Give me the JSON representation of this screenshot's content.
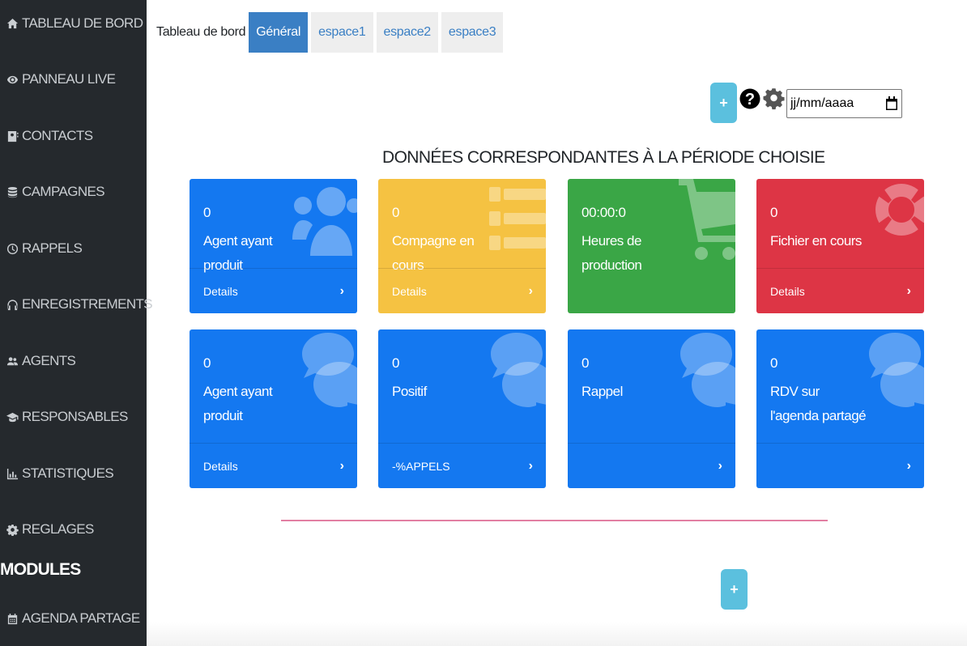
{
  "sidebar": {
    "items": [
      {
        "label": "TABLEAU DE BORD",
        "icon": "home-icon"
      },
      {
        "label": "PANNEAU LIVE",
        "icon": "eye-icon"
      },
      {
        "label": "CONTACTS",
        "icon": "address-book-icon"
      },
      {
        "label": "CAMPAGNES",
        "icon": "database-icon"
      },
      {
        "label": "RAPPELS",
        "icon": "clock-icon"
      },
      {
        "label": "ENREGISTREMENTS",
        "icon": "headphones-icon"
      },
      {
        "label": "AGENTS",
        "icon": "users-icon"
      },
      {
        "label": "RESPONSABLES",
        "icon": "graduation-cap-icon"
      },
      {
        "label": "STATISTIQUES",
        "icon": "chart-icon"
      },
      {
        "label": "REGLAGES",
        "icon": "gear-icon"
      }
    ],
    "modules_heading": "MODULES",
    "modules": [
      {
        "label": "AGENDA PARTAGE",
        "icon": "calendar-icon"
      }
    ]
  },
  "tabs": {
    "title": "Tableau de bord",
    "items": [
      "Général",
      "espace1",
      "espace2",
      "espace3"
    ],
    "active": "Général"
  },
  "toolbar": {
    "add_label": "+",
    "date_placeholder": "jj/mm/aaaa"
  },
  "section_title": "DONNÉES CORRESPONDANTES À LA PÉRIODE CHOISIE",
  "cards": [
    {
      "value": "0",
      "label": "Agent ayant produit",
      "footer": "Details",
      "color": "#1478f0",
      "icon": "users-icon"
    },
    {
      "value": "0",
      "label": "Compagne en cours",
      "footer": "Details",
      "color": "#f5c242",
      "icon": "list-icon"
    },
    {
      "value": "00:00:0",
      "label": "Heures de production",
      "footer": "",
      "color": "#3aa646",
      "icon": "shopping-cart-icon"
    },
    {
      "value": "0",
      "label": "Fichier en cours",
      "footer": "Details",
      "color": "#dd3545",
      "icon": "life-ring-icon"
    },
    {
      "value": "0",
      "label": "Agent ayant produit",
      "footer": "Details",
      "color": "#1478f0",
      "icon": "comments-icon"
    },
    {
      "value": "0",
      "label": "Positif",
      "footer": "-%APPELS",
      "color": "#1478f0",
      "icon": "comments-icon"
    },
    {
      "value": "0",
      "label": "Rappel",
      "footer": "",
      "color": "#1478f0",
      "icon": "comments-icon"
    },
    {
      "value": "0",
      "label": "RDV sur l'agenda partagé",
      "footer": "",
      "color": "#1478f0",
      "icon": "comments-icon"
    }
  ],
  "chevron": "›",
  "bottom": {
    "add_label": "+"
  }
}
